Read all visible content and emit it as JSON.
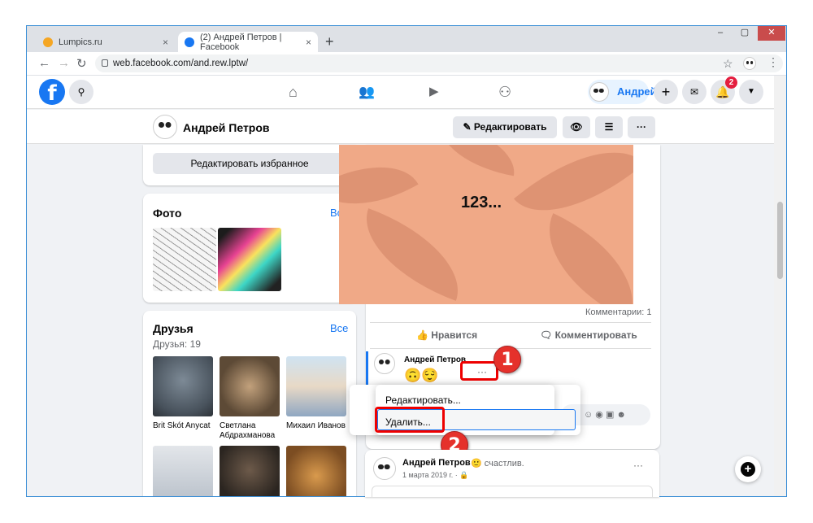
{
  "browser": {
    "tabs": [
      {
        "title": "Lumpics.ru",
        "active": false
      },
      {
        "title": "(2) Андрей Петров | Facebook",
        "active": true
      }
    ],
    "new_tab": "+",
    "close_glyph": "×",
    "window_controls": [
      "–",
      "▢",
      "✕"
    ],
    "nav": {
      "back": "←",
      "forward": "→",
      "reload": "↻"
    },
    "url": "web.facebook.com/and.rew.lptw/",
    "star": "☆"
  },
  "fbnav": {
    "logo": "f",
    "search_icon": "🔍",
    "icons": [
      "⌂",
      "👥",
      "▶",
      "⚇"
    ],
    "user_name": "Андрей",
    "plus": "+",
    "messenger": "✉",
    "notifications_count": "2",
    "menu_arrow": "▼"
  },
  "profile": {
    "name": "Андрей Петров",
    "edit_button": "✎ Редактировать про...",
    "view_icon": "👁",
    "list_icon": "☰",
    "more": "···"
  },
  "left": {
    "edit_featured": "Редактировать избранное",
    "photos_title": "Фото",
    "see_all": "Все",
    "friends_title": "Друзья",
    "friends_count": "Друзья: 19",
    "friends": [
      {
        "name": "Brit Skót Anycat"
      },
      {
        "name": "Светлана Абдрахманова"
      },
      {
        "name": "Михаил Иванов"
      }
    ]
  },
  "post": {
    "image_text": "123...",
    "comments_count": "Комментарии: 1",
    "like": "Нравится",
    "comment": "Комментировать",
    "comment_author": "Андрей Петров",
    "comment_text": "🙃😌",
    "comment_more": "···"
  },
  "context_menu": {
    "edit": "Редактировать...",
    "delete": "Удалить..."
  },
  "second_post": {
    "author": "Андрей Петров",
    "status": "🙂 счастлив.",
    "date": "1 марта 2019 г. · 🔒",
    "more": "···"
  },
  "markers": [
    "1",
    "2"
  ],
  "fab": "+",
  "colors": {
    "fb_blue": "#1877f2",
    "marker_red": "#e5312b"
  }
}
